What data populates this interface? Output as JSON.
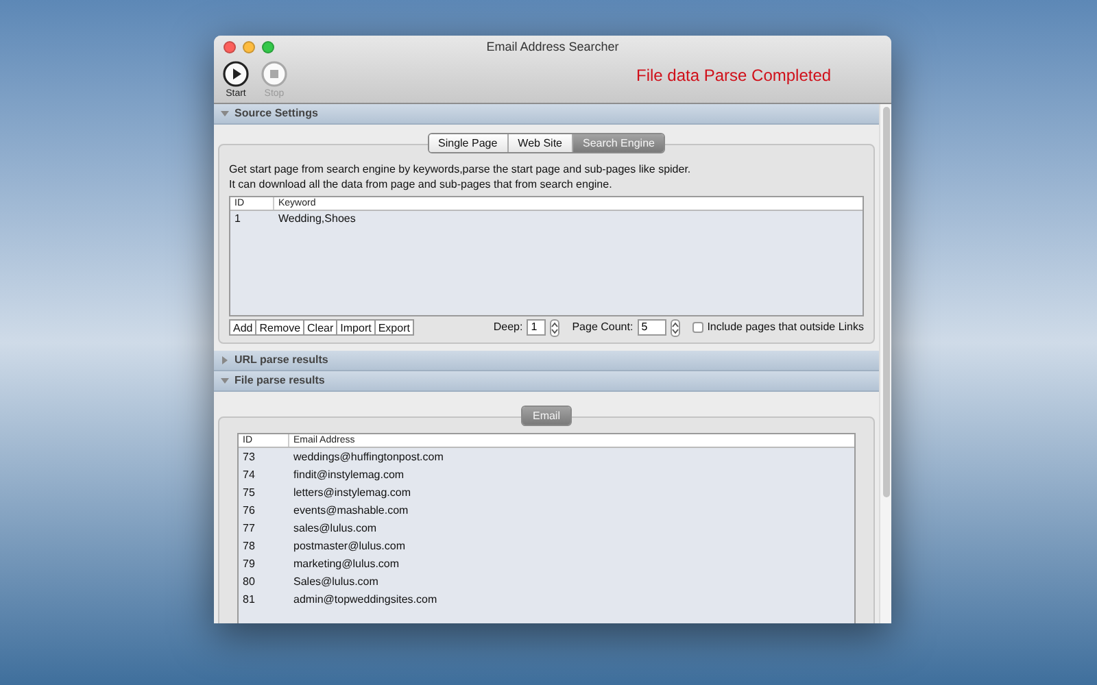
{
  "window": {
    "title": "Email Address Searcher"
  },
  "toolbar": {
    "buttons": [
      {
        "label": "Start",
        "kind": "play",
        "disabled": false
      },
      {
        "label": "Stop",
        "kind": "stop",
        "disabled": true
      }
    ],
    "status": "File data Parse Completed"
  },
  "sections": [
    {
      "title": "Source Settings",
      "expanded": true,
      "kind": "source"
    },
    {
      "title": "URL parse results",
      "expanded": false
    },
    {
      "title": "File parse results",
      "expanded": true,
      "kind": "file"
    }
  ],
  "source": {
    "tabs": [
      {
        "label": "Single Page",
        "selected": false
      },
      {
        "label": "Web Site",
        "selected": false
      },
      {
        "label": "Search Engine",
        "selected": true
      }
    ],
    "description": [
      "Get start page from search engine by keywords,parse the start page and sub-pages like spider.",
      "It can download all the data from page and sub-pages that from search engine."
    ],
    "table": {
      "columns": [
        "ID",
        "Keyword"
      ],
      "rows": [
        [
          "1",
          "Wedding,Shoes"
        ]
      ]
    },
    "buttons": [
      "Add",
      "Remove",
      "Clear",
      "Import",
      "Export"
    ],
    "deep": {
      "label": "Deep:",
      "value": "1"
    },
    "page_count": {
      "label": "Page Count:",
      "value": "5"
    },
    "include_outside": {
      "label": "Include pages that outside Links",
      "checked": false
    }
  },
  "results": {
    "tabs": [
      {
        "label": "Email",
        "selected": true
      }
    ],
    "table": {
      "columns": [
        "ID",
        "Email Address"
      ],
      "rows": [
        [
          "73",
          "weddings@huffingtonpost.com"
        ],
        [
          "74",
          "findit@instylemag.com"
        ],
        [
          "75",
          "letters@instylemag.com"
        ],
        [
          "76",
          "events@mashable.com"
        ],
        [
          "77",
          "sales@lulus.com"
        ],
        [
          "78",
          "postmaster@lulus.com"
        ],
        [
          "79",
          "marketing@lulus.com"
        ],
        [
          "80",
          "Sales@lulus.com"
        ],
        [
          "81",
          "admin@topweddingsites.com"
        ]
      ]
    }
  }
}
